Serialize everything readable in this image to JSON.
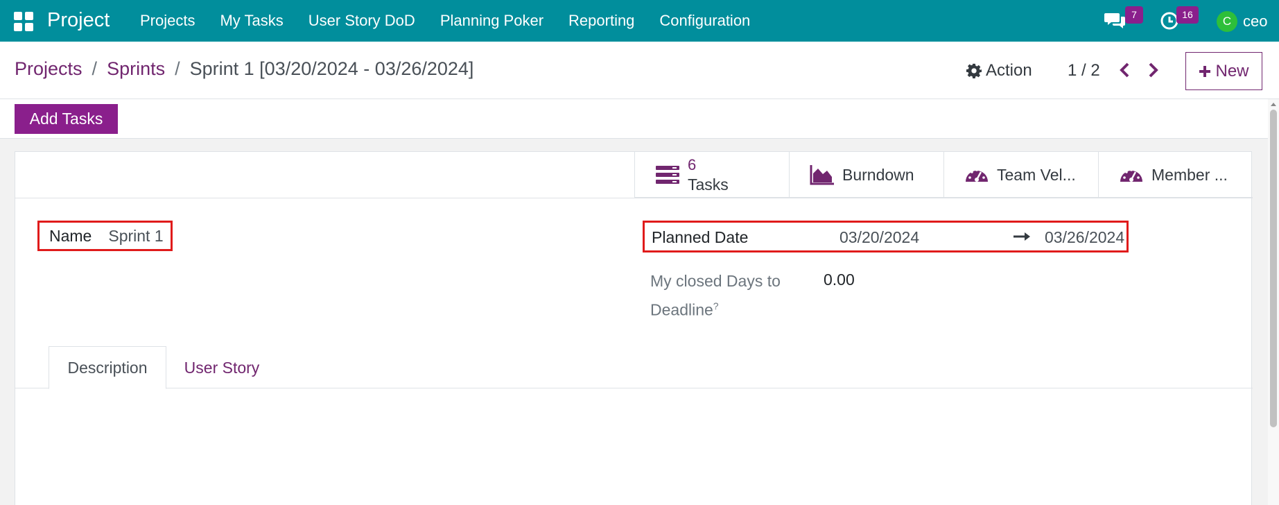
{
  "topbar": {
    "app_title": "Project",
    "menu": [
      "Projects",
      "My Tasks",
      "User Story DoD",
      "Planning Poker",
      "Reporting",
      "Configuration"
    ],
    "messages_count": "7",
    "activities_count": "16",
    "avatar_initial": "C",
    "username": "ceo",
    "bg_color": "#018e9c"
  },
  "breadcrumb": {
    "projects": "Projects",
    "sprints": "Sprints",
    "current": "Sprint 1 [03/20/2024 - 03/26/2024]",
    "sep": "/"
  },
  "control": {
    "action_label": "Action",
    "pager": "1 / 2",
    "new_label": "New"
  },
  "statusbar": {
    "add_tasks_label": "Add Tasks"
  },
  "smart_buttons": {
    "tasks_count": "6",
    "tasks_label": "Tasks",
    "burndown_label": "Burndown",
    "team_velocity_label": "Team Vel...",
    "member_label": "Member ..."
  },
  "form": {
    "name_label": "Name",
    "name_value": "Sprint 1",
    "planned_date_label": "Planned Date",
    "date_start": "03/20/2024",
    "date_end": "03/26/2024",
    "closed_days_label": "My closed Days to Deadline",
    "closed_days_help": "?",
    "closed_days_value": "0.00"
  },
  "tabs": {
    "description": "Description",
    "user_story": "User Story"
  },
  "colors": {
    "accent": "#71266f",
    "primary_button": "#8a1f8c",
    "highlight": "#e01b1b"
  }
}
